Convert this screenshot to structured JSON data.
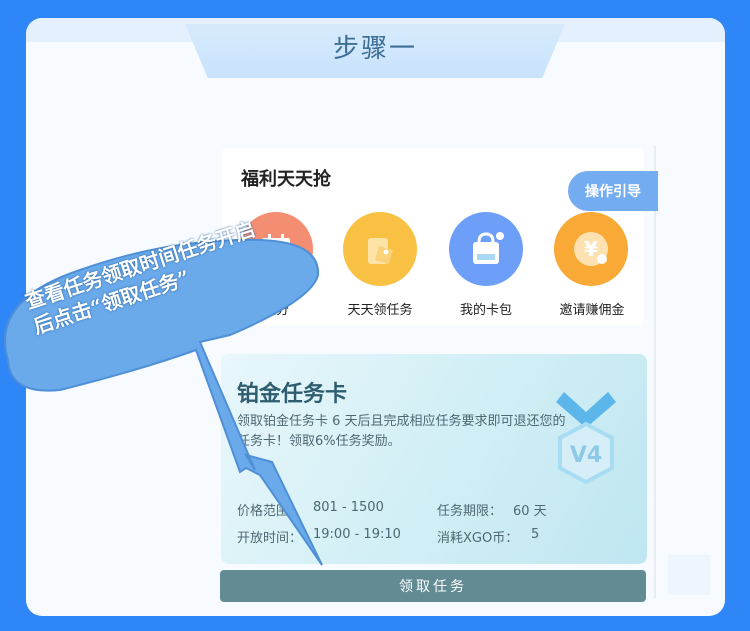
{
  "step": {
    "title": "步骤一"
  },
  "welfare": {
    "title": "福利天天抢",
    "guide_label": "操作引导",
    "items": [
      {
        "label": "积分",
        "icon": "calendar-icon",
        "color": "#f48e72"
      },
      {
        "label": "天天领任务",
        "icon": "gift-tag-icon",
        "color": "#f9c143"
      },
      {
        "label": "我的卡包",
        "icon": "bag-icon",
        "color": "#6e9ff8"
      },
      {
        "label": "邀请赚佣金",
        "icon": "yen-icon",
        "color": "#f9a935"
      }
    ]
  },
  "task_card": {
    "title": "铂金任务卡",
    "description": "领取铂金任务卡 6 天后且完成相应任务要求即可退还您的任务卡！领取6%任务奖励。",
    "price_label": "价格范围",
    "price_value": "801 - 1500",
    "period_label": "任务期限：",
    "period_value": "60 天",
    "open_label": "开放时间：",
    "open_value": "19:00 - 19:10",
    "cost_label": "消耗XGO币：",
    "cost_value": "5",
    "badge": "V4",
    "button_label": "领取任务"
  },
  "callout": {
    "line1": "查看任务领取时间任务开启",
    "line2": "后点击“领取任务”"
  },
  "colors": {
    "background": "#2f86f6",
    "callout": "#6aa9ea",
    "button": "#628b93",
    "title": "#3d6f96"
  }
}
